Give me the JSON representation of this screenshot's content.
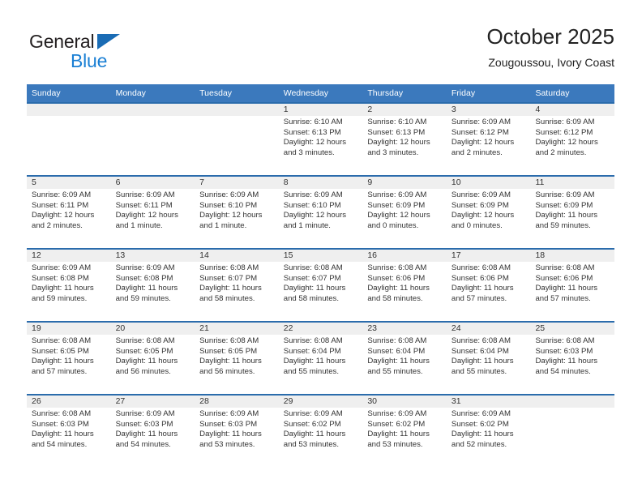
{
  "brand": {
    "name_part1": "General",
    "name_part2": "Blue",
    "triangle_color": "#1a6cb5",
    "blue_color": "#1a7fd4"
  },
  "header": {
    "title": "October 2025",
    "subtitle": "Zougoussou, Ivory Coast"
  },
  "theme": {
    "header_band": "#3b79bd",
    "row_divider": "#2b6cac",
    "date_band": "#efefef",
    "text": "#333333"
  },
  "weekdays": [
    "Sunday",
    "Monday",
    "Tuesday",
    "Wednesday",
    "Thursday",
    "Friday",
    "Saturday"
  ],
  "weeks": [
    {
      "days": [
        {
          "date": "",
          "sunrise": "",
          "sunset": "",
          "daylight1": "",
          "daylight2": "",
          "empty": true
        },
        {
          "date": "",
          "sunrise": "",
          "sunset": "",
          "daylight1": "",
          "daylight2": "",
          "empty": true
        },
        {
          "date": "",
          "sunrise": "",
          "sunset": "",
          "daylight1": "",
          "daylight2": "",
          "empty": true
        },
        {
          "date": "1",
          "sunrise": "Sunrise: 6:10 AM",
          "sunset": "Sunset: 6:13 PM",
          "daylight1": "Daylight: 12 hours",
          "daylight2": "and 3 minutes.",
          "empty": false
        },
        {
          "date": "2",
          "sunrise": "Sunrise: 6:10 AM",
          "sunset": "Sunset: 6:13 PM",
          "daylight1": "Daylight: 12 hours",
          "daylight2": "and 3 minutes.",
          "empty": false
        },
        {
          "date": "3",
          "sunrise": "Sunrise: 6:09 AM",
          "sunset": "Sunset: 6:12 PM",
          "daylight1": "Daylight: 12 hours",
          "daylight2": "and 2 minutes.",
          "empty": false
        },
        {
          "date": "4",
          "sunrise": "Sunrise: 6:09 AM",
          "sunset": "Sunset: 6:12 PM",
          "daylight1": "Daylight: 12 hours",
          "daylight2": "and 2 minutes.",
          "empty": false
        }
      ]
    },
    {
      "days": [
        {
          "date": "5",
          "sunrise": "Sunrise: 6:09 AM",
          "sunset": "Sunset: 6:11 PM",
          "daylight1": "Daylight: 12 hours",
          "daylight2": "and 2 minutes.",
          "empty": false
        },
        {
          "date": "6",
          "sunrise": "Sunrise: 6:09 AM",
          "sunset": "Sunset: 6:11 PM",
          "daylight1": "Daylight: 12 hours",
          "daylight2": "and 1 minute.",
          "empty": false
        },
        {
          "date": "7",
          "sunrise": "Sunrise: 6:09 AM",
          "sunset": "Sunset: 6:10 PM",
          "daylight1": "Daylight: 12 hours",
          "daylight2": "and 1 minute.",
          "empty": false
        },
        {
          "date": "8",
          "sunrise": "Sunrise: 6:09 AM",
          "sunset": "Sunset: 6:10 PM",
          "daylight1": "Daylight: 12 hours",
          "daylight2": "and 1 minute.",
          "empty": false
        },
        {
          "date": "9",
          "sunrise": "Sunrise: 6:09 AM",
          "sunset": "Sunset: 6:09 PM",
          "daylight1": "Daylight: 12 hours",
          "daylight2": "and 0 minutes.",
          "empty": false
        },
        {
          "date": "10",
          "sunrise": "Sunrise: 6:09 AM",
          "sunset": "Sunset: 6:09 PM",
          "daylight1": "Daylight: 12 hours",
          "daylight2": "and 0 minutes.",
          "empty": false
        },
        {
          "date": "11",
          "sunrise": "Sunrise: 6:09 AM",
          "sunset": "Sunset: 6:09 PM",
          "daylight1": "Daylight: 11 hours",
          "daylight2": "and 59 minutes.",
          "empty": false
        }
      ]
    },
    {
      "days": [
        {
          "date": "12",
          "sunrise": "Sunrise: 6:09 AM",
          "sunset": "Sunset: 6:08 PM",
          "daylight1": "Daylight: 11 hours",
          "daylight2": "and 59 minutes.",
          "empty": false
        },
        {
          "date": "13",
          "sunrise": "Sunrise: 6:09 AM",
          "sunset": "Sunset: 6:08 PM",
          "daylight1": "Daylight: 11 hours",
          "daylight2": "and 59 minutes.",
          "empty": false
        },
        {
          "date": "14",
          "sunrise": "Sunrise: 6:08 AM",
          "sunset": "Sunset: 6:07 PM",
          "daylight1": "Daylight: 11 hours",
          "daylight2": "and 58 minutes.",
          "empty": false
        },
        {
          "date": "15",
          "sunrise": "Sunrise: 6:08 AM",
          "sunset": "Sunset: 6:07 PM",
          "daylight1": "Daylight: 11 hours",
          "daylight2": "and 58 minutes.",
          "empty": false
        },
        {
          "date": "16",
          "sunrise": "Sunrise: 6:08 AM",
          "sunset": "Sunset: 6:06 PM",
          "daylight1": "Daylight: 11 hours",
          "daylight2": "and 58 minutes.",
          "empty": false
        },
        {
          "date": "17",
          "sunrise": "Sunrise: 6:08 AM",
          "sunset": "Sunset: 6:06 PM",
          "daylight1": "Daylight: 11 hours",
          "daylight2": "and 57 minutes.",
          "empty": false
        },
        {
          "date": "18",
          "sunrise": "Sunrise: 6:08 AM",
          "sunset": "Sunset: 6:06 PM",
          "daylight1": "Daylight: 11 hours",
          "daylight2": "and 57 minutes.",
          "empty": false
        }
      ]
    },
    {
      "days": [
        {
          "date": "19",
          "sunrise": "Sunrise: 6:08 AM",
          "sunset": "Sunset: 6:05 PM",
          "daylight1": "Daylight: 11 hours",
          "daylight2": "and 57 minutes.",
          "empty": false
        },
        {
          "date": "20",
          "sunrise": "Sunrise: 6:08 AM",
          "sunset": "Sunset: 6:05 PM",
          "daylight1": "Daylight: 11 hours",
          "daylight2": "and 56 minutes.",
          "empty": false
        },
        {
          "date": "21",
          "sunrise": "Sunrise: 6:08 AM",
          "sunset": "Sunset: 6:05 PM",
          "daylight1": "Daylight: 11 hours",
          "daylight2": "and 56 minutes.",
          "empty": false
        },
        {
          "date": "22",
          "sunrise": "Sunrise: 6:08 AM",
          "sunset": "Sunset: 6:04 PM",
          "daylight1": "Daylight: 11 hours",
          "daylight2": "and 55 minutes.",
          "empty": false
        },
        {
          "date": "23",
          "sunrise": "Sunrise: 6:08 AM",
          "sunset": "Sunset: 6:04 PM",
          "daylight1": "Daylight: 11 hours",
          "daylight2": "and 55 minutes.",
          "empty": false
        },
        {
          "date": "24",
          "sunrise": "Sunrise: 6:08 AM",
          "sunset": "Sunset: 6:04 PM",
          "daylight1": "Daylight: 11 hours",
          "daylight2": "and 55 minutes.",
          "empty": false
        },
        {
          "date": "25",
          "sunrise": "Sunrise: 6:08 AM",
          "sunset": "Sunset: 6:03 PM",
          "daylight1": "Daylight: 11 hours",
          "daylight2": "and 54 minutes.",
          "empty": false
        }
      ]
    },
    {
      "days": [
        {
          "date": "26",
          "sunrise": "Sunrise: 6:08 AM",
          "sunset": "Sunset: 6:03 PM",
          "daylight1": "Daylight: 11 hours",
          "daylight2": "and 54 minutes.",
          "empty": false
        },
        {
          "date": "27",
          "sunrise": "Sunrise: 6:09 AM",
          "sunset": "Sunset: 6:03 PM",
          "daylight1": "Daylight: 11 hours",
          "daylight2": "and 54 minutes.",
          "empty": false
        },
        {
          "date": "28",
          "sunrise": "Sunrise: 6:09 AM",
          "sunset": "Sunset: 6:03 PM",
          "daylight1": "Daylight: 11 hours",
          "daylight2": "and 53 minutes.",
          "empty": false
        },
        {
          "date": "29",
          "sunrise": "Sunrise: 6:09 AM",
          "sunset": "Sunset: 6:02 PM",
          "daylight1": "Daylight: 11 hours",
          "daylight2": "and 53 minutes.",
          "empty": false
        },
        {
          "date": "30",
          "sunrise": "Sunrise: 6:09 AM",
          "sunset": "Sunset: 6:02 PM",
          "daylight1": "Daylight: 11 hours",
          "daylight2": "and 53 minutes.",
          "empty": false
        },
        {
          "date": "31",
          "sunrise": "Sunrise: 6:09 AM",
          "sunset": "Sunset: 6:02 PM",
          "daylight1": "Daylight: 11 hours",
          "daylight2": "and 52 minutes.",
          "empty": false
        },
        {
          "date": "",
          "sunrise": "",
          "sunset": "",
          "daylight1": "",
          "daylight2": "",
          "empty": true
        }
      ]
    }
  ]
}
